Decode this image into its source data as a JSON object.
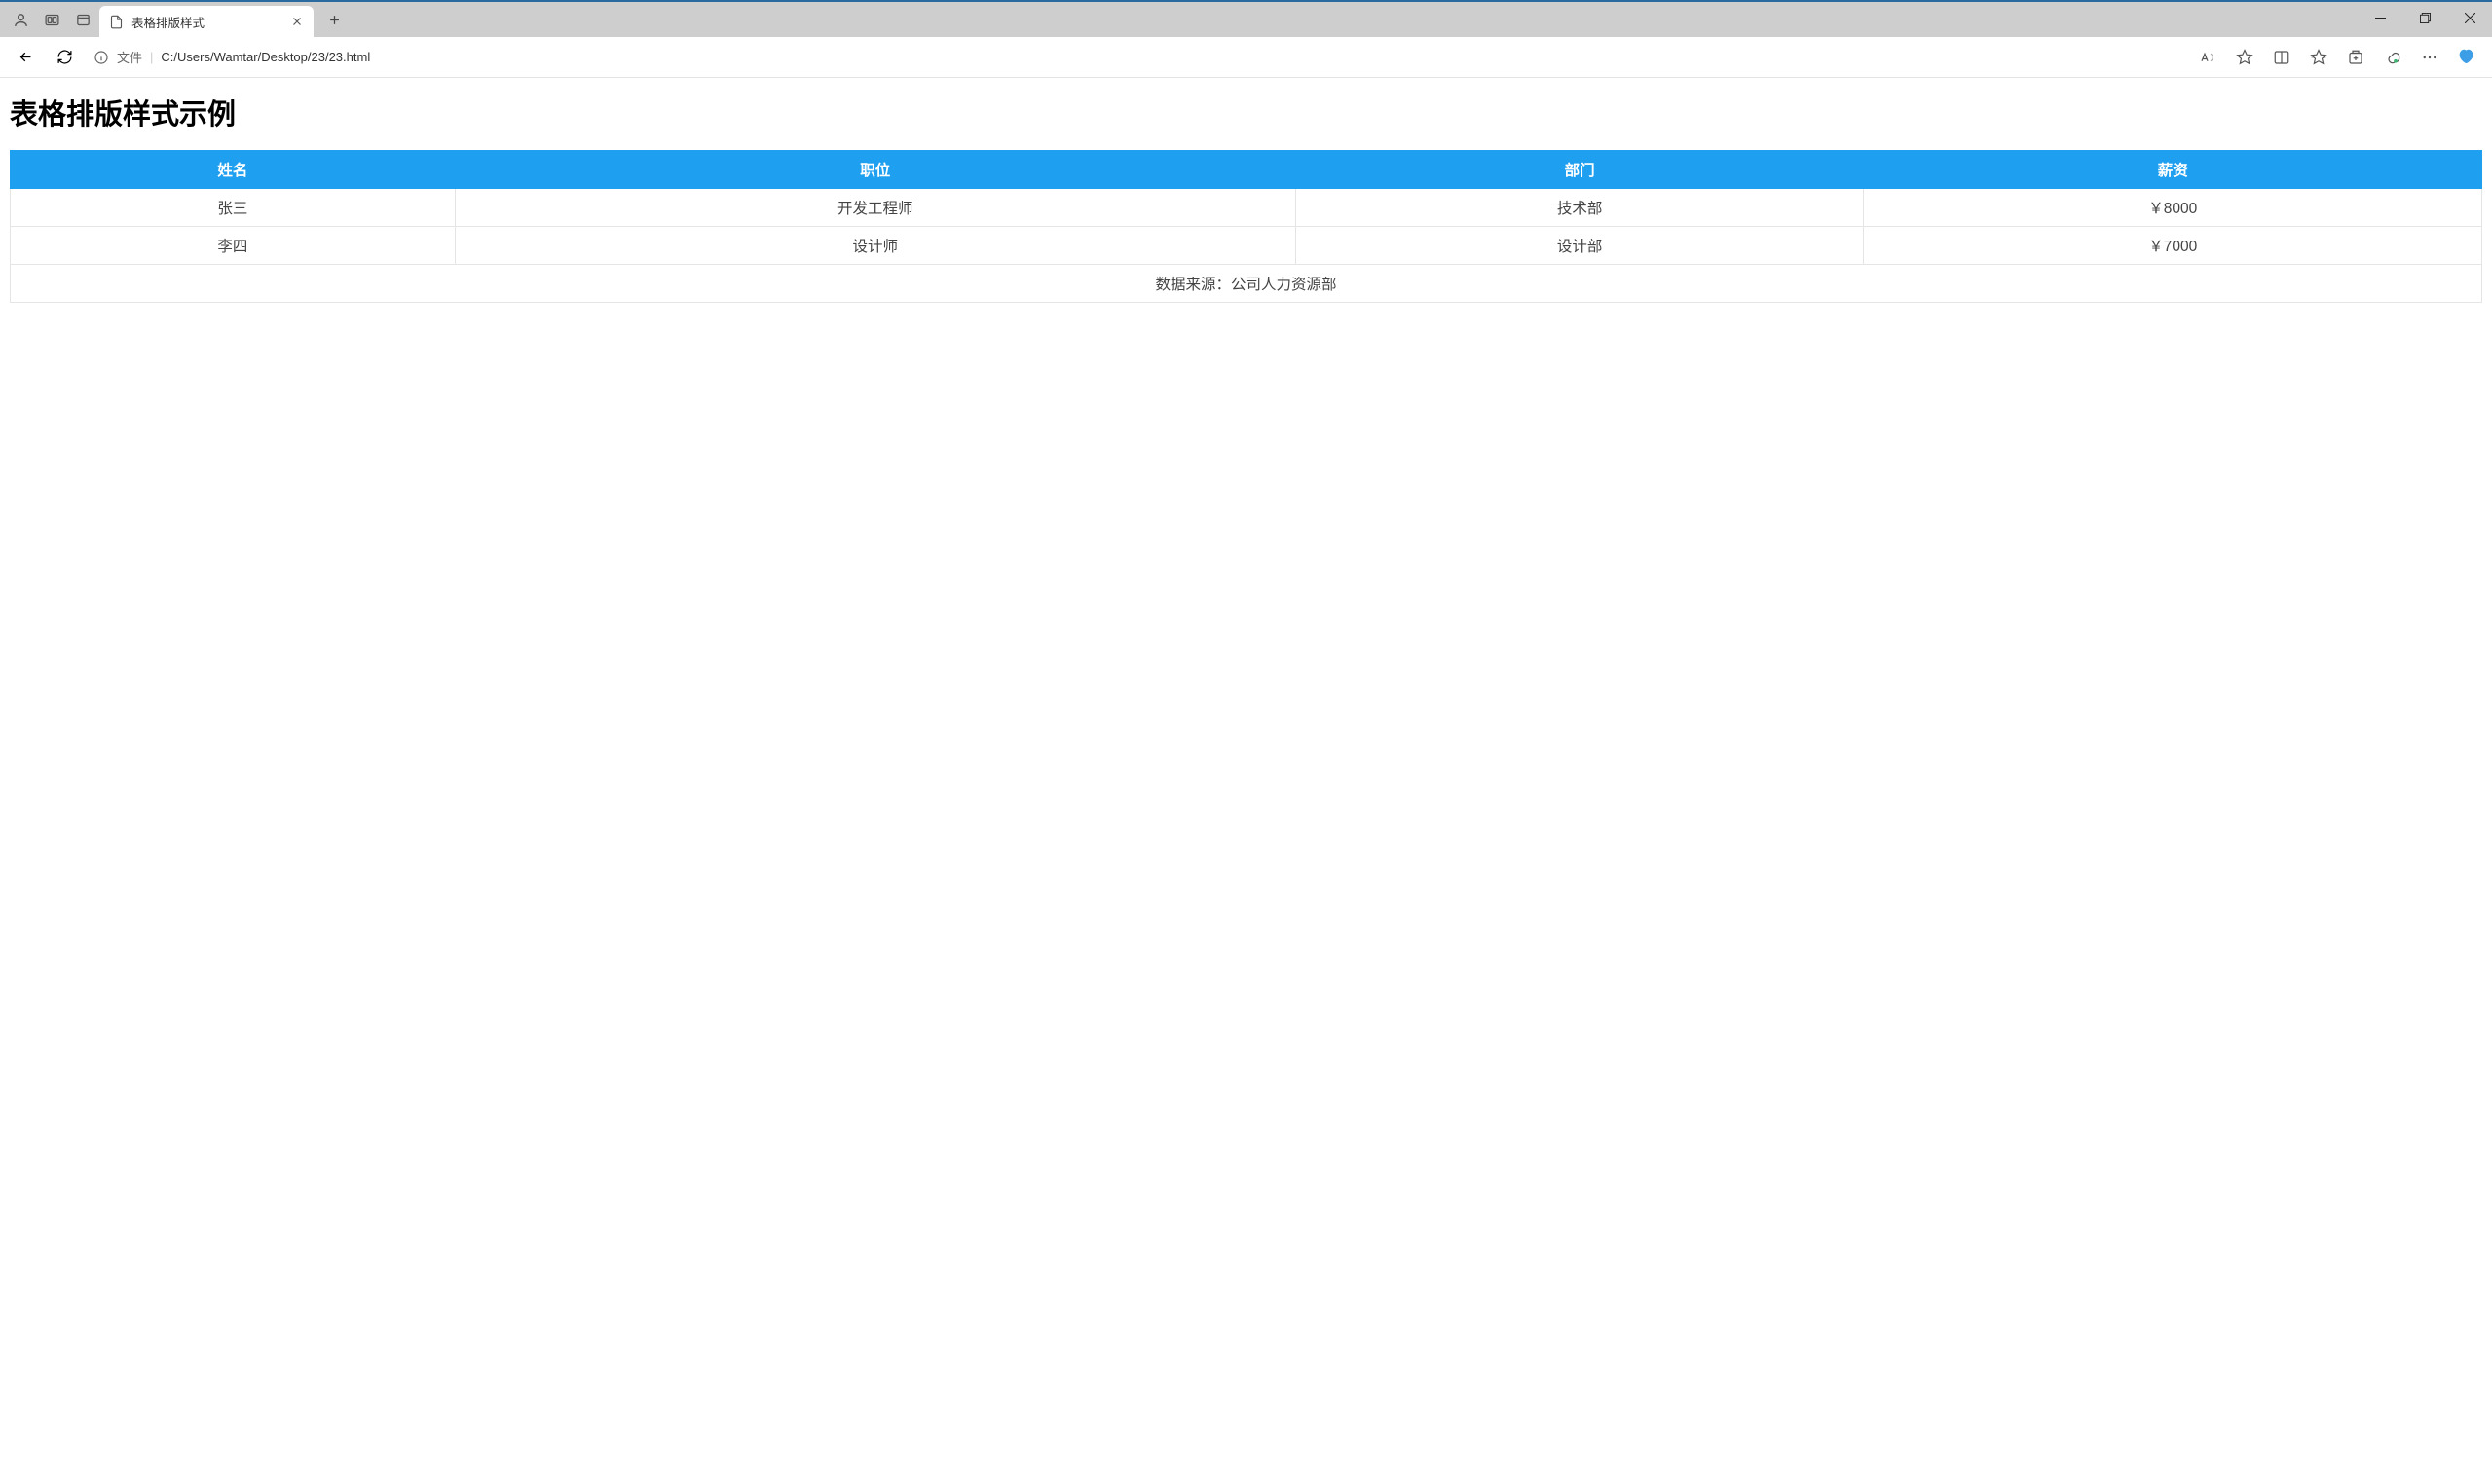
{
  "browser": {
    "tab_title": "表格排版样式",
    "address_label": "文件",
    "address_path": "C:/Users/Wamtar/Desktop/23/23.html"
  },
  "page": {
    "heading": "表格排版样式示例",
    "table": {
      "headers": [
        "姓名",
        "职位",
        "部门",
        "薪资"
      ],
      "rows": [
        {
          "name": "张三",
          "position": "开发工程师",
          "department": "技术部",
          "salary": "￥8000"
        },
        {
          "name": "李四",
          "position": "设计师",
          "department": "设计部",
          "salary": "￥7000"
        }
      ],
      "footer": "数据来源：公司人力资源部"
    }
  }
}
